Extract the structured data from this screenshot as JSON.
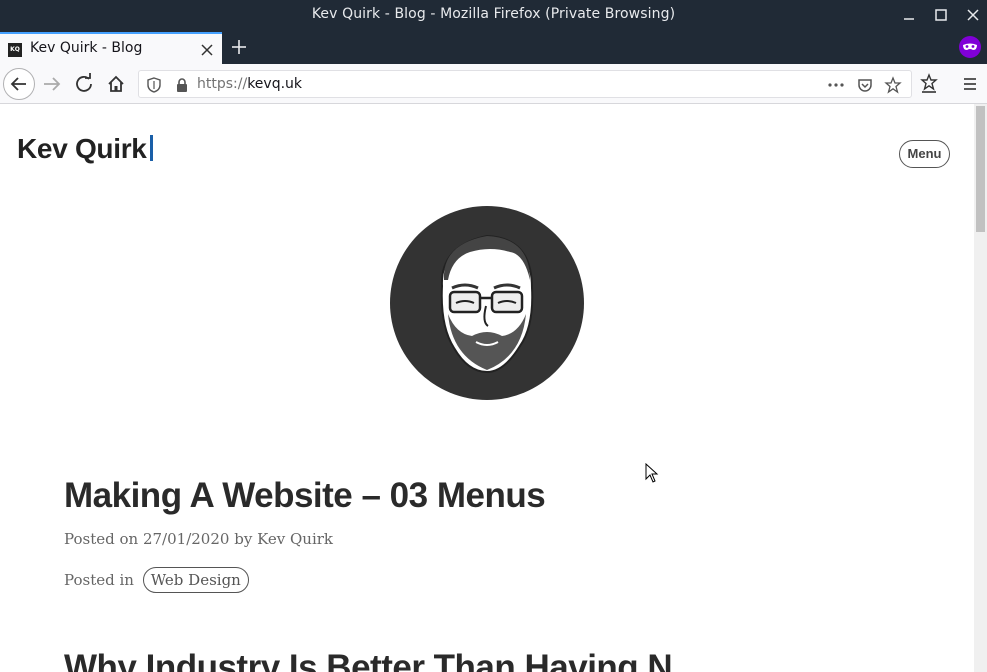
{
  "window": {
    "title": "Kev Quirk - Blog - Mozilla Firefox (Private Browsing)"
  },
  "tabs": [
    {
      "title": "Kev Quirk - Blog",
      "favicon_text": "KQ"
    }
  ],
  "urlbar": {
    "scheme": "https://",
    "host": "kevq.uk"
  },
  "site": {
    "title": "Kev Quirk",
    "menu_label": "Menu"
  },
  "posts": [
    {
      "title": "Making A Website – 03 Menus",
      "posted_on_prefix": "Posted on",
      "date": "27/01/2020",
      "by_prefix": "by",
      "author": "Kev Quirk",
      "posted_in_prefix": "Posted in",
      "category": "Web Design"
    },
    {
      "title": "Why Industry Is Better Than Having N"
    }
  ],
  "colors": {
    "titlebar": "#202a36",
    "tab_accent": "#45a1ff",
    "private_badge": "#8000d7",
    "avatar_bg": "#333333",
    "caret": "#1a5fa8"
  }
}
